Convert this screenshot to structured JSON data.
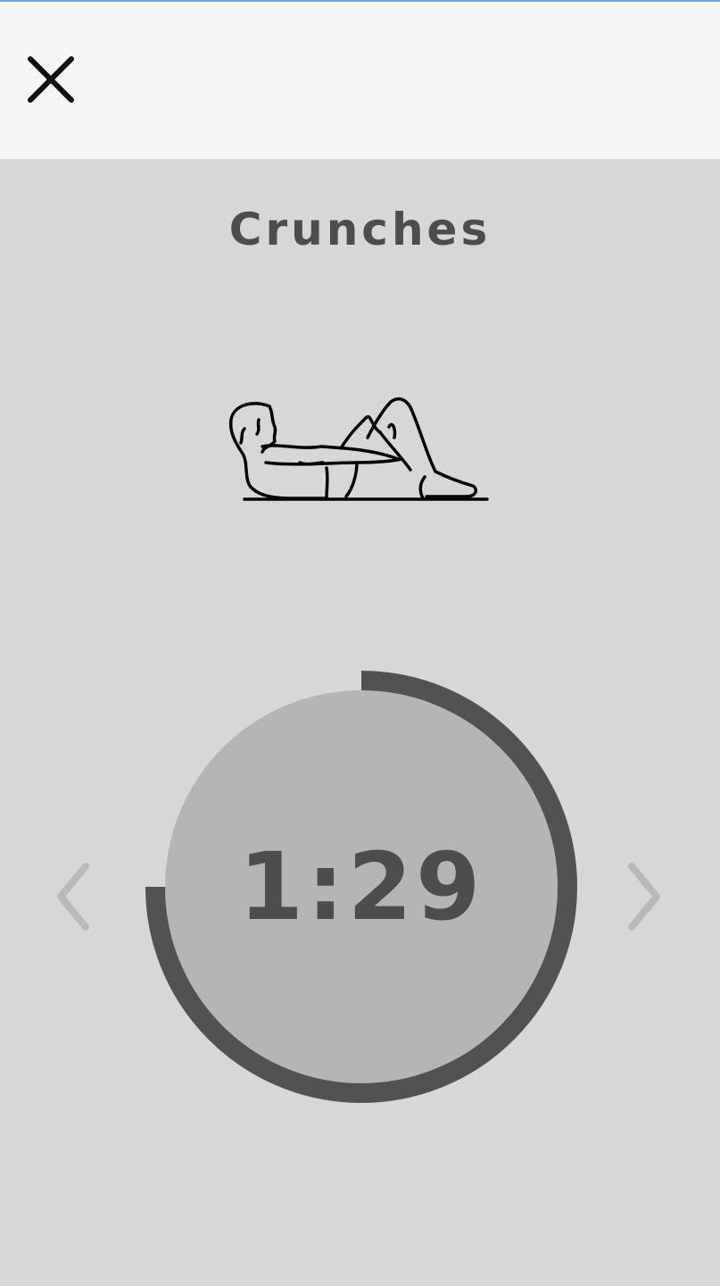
{
  "header": {
    "close_icon": "close-icon"
  },
  "exercise": {
    "name": "Crunches",
    "illustration_icon": "crunches-illustration"
  },
  "timer": {
    "display": "1:29",
    "progress_fraction": 0.75
  },
  "navigation": {
    "prev_icon": "chevron-left-icon",
    "next_icon": "chevron-right-icon"
  },
  "colors": {
    "header_bg": "#f5f5f5",
    "page_bg": "#d7d7d7",
    "circle_fill": "#b5b5b5",
    "progress_ring": "#525252",
    "text": "#4d4d4d",
    "nav_chevron": "#b9b9b9"
  }
}
